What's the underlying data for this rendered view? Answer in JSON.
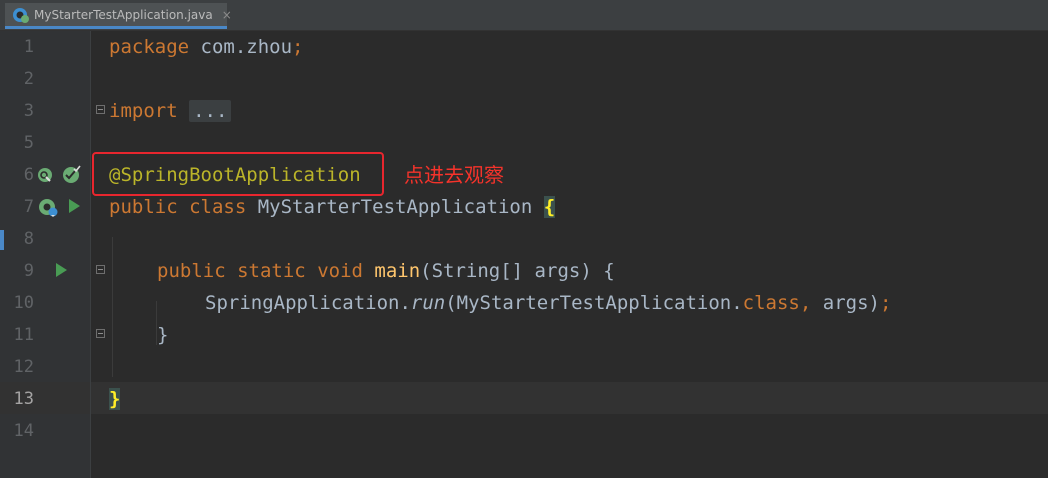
{
  "tab": {
    "label": "MyStarterTestApplication.java",
    "icon": "spring-java-class-icon",
    "close_glyph": "×"
  },
  "line_numbers": [
    "1",
    "2",
    "3",
    "5",
    "6",
    "7",
    "8",
    "9",
    "10",
    "11",
    "12",
    "13",
    "14"
  ],
  "current_line": "13",
  "code": {
    "line1": {
      "kw": "package",
      "rest": " com.zhou",
      "semi": ";"
    },
    "line3": {
      "kw": "import",
      "fold": "..."
    },
    "line6": {
      "annotation": "@SpringBootApplication"
    },
    "line7": {
      "kw1": "public",
      "kw2": "class",
      "name": " MyStarterTestApplication ",
      "brace": "{"
    },
    "line9": {
      "kw1": "public",
      "kw2": "static",
      "kw3": "void",
      "method": "main",
      "params": "(String[] args) {"
    },
    "line10": {
      "cls": "SpringApplication.",
      "call": "run",
      "open": "(MyStarterTestApplication.",
      "kw": "class",
      "comma": ",",
      "rest": " args)",
      "semi": ";"
    },
    "line11": {
      "brace": "}"
    },
    "line13": {
      "brace": "}"
    }
  },
  "annotation_note": "点进去观察",
  "colors": {
    "background": "#2b2b2b",
    "keyword": "#cc7832",
    "annotation": "#bbb529",
    "method": "#ffc66d",
    "highlight_box": "#e8262e",
    "run_icon": "#499c54"
  }
}
